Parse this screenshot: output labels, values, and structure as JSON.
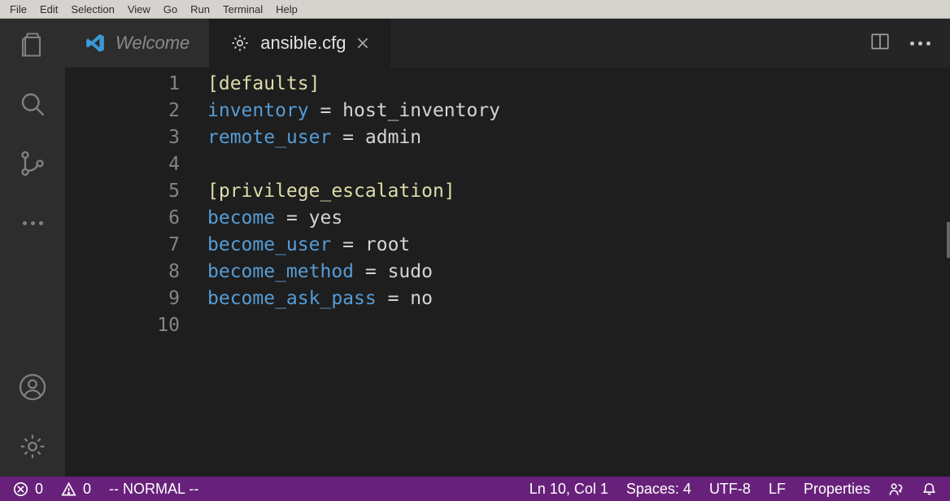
{
  "menubar": [
    "File",
    "Edit",
    "Selection",
    "View",
    "Go",
    "Run",
    "Terminal",
    "Help"
  ],
  "tabs": {
    "welcome": "Welcome",
    "active_file": "ansible.cfg"
  },
  "code": {
    "line_numbers": [
      "1",
      "2",
      "3",
      "4",
      "5",
      "6",
      "7",
      "8",
      "9",
      "10"
    ],
    "lines": [
      {
        "section": "[defaults]"
      },
      {
        "key": "inventory",
        "val": "host_inventory"
      },
      {
        "key": "remote_user",
        "val": "admin"
      },
      {
        "blank": true
      },
      {
        "section": "[privilege_escalation]"
      },
      {
        "key": "become",
        "val": "yes"
      },
      {
        "key": "become_user",
        "val": "root"
      },
      {
        "key": "become_method",
        "val": "sudo"
      },
      {
        "key": "become_ask_pass",
        "val": "no"
      },
      {
        "blank": true
      }
    ]
  },
  "status": {
    "errors": "0",
    "warnings": "0",
    "vim_mode": "-- NORMAL --",
    "cursor": "Ln 10, Col 1",
    "indent": "Spaces: 4",
    "encoding": "UTF-8",
    "eol": "LF",
    "language": "Properties"
  },
  "icons": {
    "explorer": "explorer-icon",
    "search": "search-icon",
    "scm": "source-control-icon",
    "more": "more-icon",
    "account": "account-icon",
    "settings": "gear-icon",
    "vscode": "vscode-logo-icon",
    "gear_small": "gear-icon",
    "close": "close-icon",
    "split": "split-editor-icon",
    "ellipsis": "ellipsis-icon",
    "error": "error-icon",
    "warning": "warning-icon",
    "feedback": "feedback-icon",
    "bell": "bell-icon"
  }
}
